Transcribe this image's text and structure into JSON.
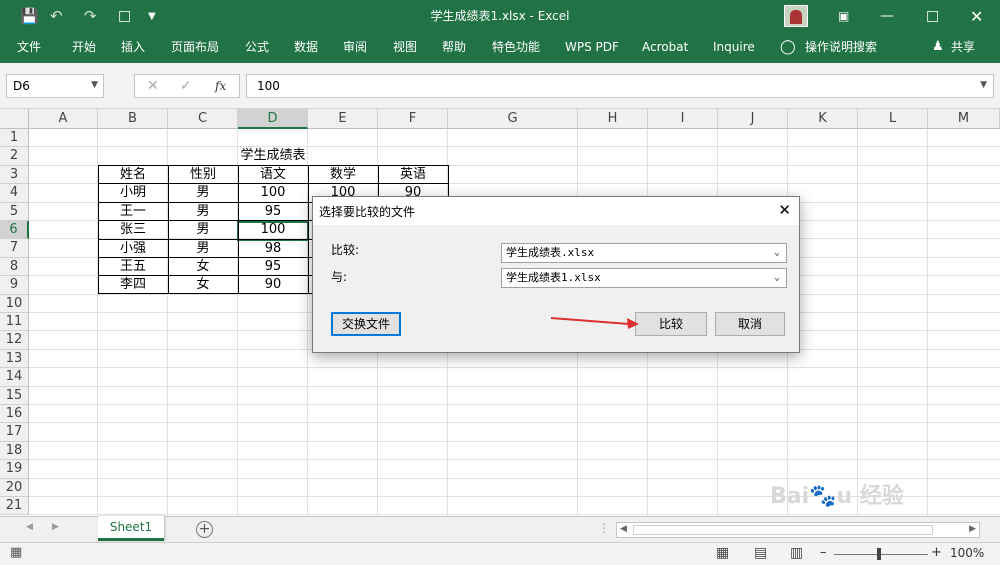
{
  "window": {
    "title": "学生成绩表1.xlsx  -  Excel"
  },
  "ribbon": {
    "tabs": [
      "文件",
      "开始",
      "插入",
      "页面布局",
      "公式",
      "数据",
      "审阅",
      "视图",
      "帮助",
      "特色功能",
      "WPS PDF",
      "Acrobat",
      "Inquire"
    ],
    "tell_me": "操作说明搜索",
    "share": "共享"
  },
  "formula": {
    "name_box": "D6",
    "value": "100",
    "fx": "fx"
  },
  "sheet": {
    "columns": [
      "A",
      "B",
      "C",
      "D",
      "E",
      "F",
      "G",
      "H",
      "I",
      "J",
      "K",
      "L",
      "M"
    ],
    "rows": [
      "1",
      "2",
      "3",
      "4",
      "5",
      "6",
      "7",
      "8",
      "9",
      "10",
      "11",
      "12",
      "13",
      "14",
      "15",
      "16",
      "17",
      "18",
      "19",
      "20",
      "21"
    ],
    "title": "学生成绩表",
    "headers": [
      "姓名",
      "性别",
      "语文",
      "数学",
      "英语"
    ],
    "names": [
      "小明",
      "王一",
      "张三",
      "小强",
      "王五",
      "李四"
    ],
    "genders": [
      "男",
      "男",
      "男",
      "男",
      "女",
      "女"
    ],
    "chinese": [
      "100",
      "95",
      "100",
      "98",
      "95",
      "90"
    ],
    "row4_math": "100",
    "row4_english": "90"
  },
  "dialog": {
    "title": "选择要比较的文件",
    "label_compare": "比较:",
    "label_with": "与:",
    "file1": "学生成绩表.xlsx",
    "file2": "学生成绩表1.xlsx",
    "swap_button": "交换文件",
    "compare_button": "比较",
    "cancel_button": "取消"
  },
  "tabs_bar": {
    "sheet_name": "Sheet1"
  },
  "status": {
    "zoom": "100%"
  },
  "colors": {
    "excel_green": "#217346",
    "arrow_red": "#e03030"
  }
}
